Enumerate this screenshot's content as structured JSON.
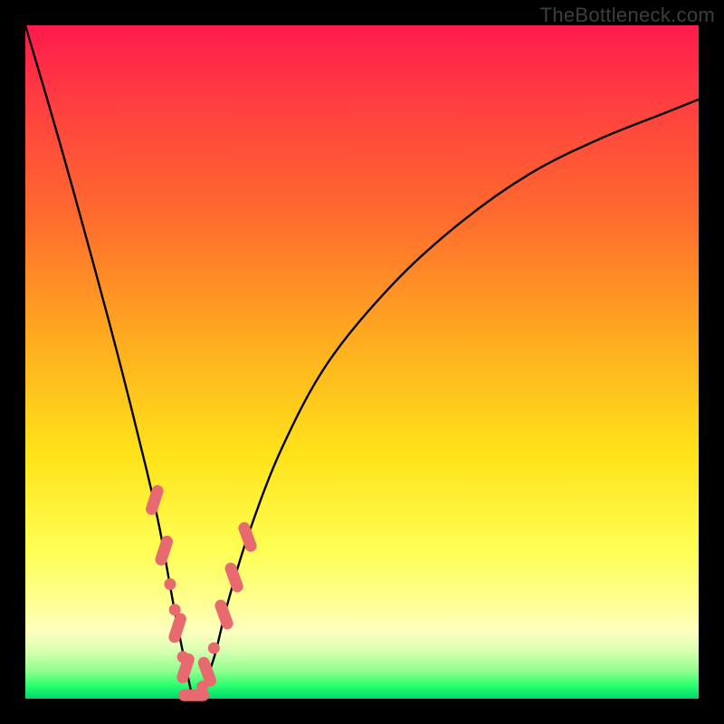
{
  "watermark": "TheBottleneck.com",
  "colors": {
    "curve_stroke": "#000000",
    "marker_fill": "#e86a6f",
    "marker_stroke": "#6b1f22"
  },
  "chart_data": {
    "type": "line",
    "title": "",
    "xlabel": "",
    "ylabel": "",
    "xlim": [
      0,
      100
    ],
    "ylim": [
      0,
      100
    ],
    "grid": false,
    "series": [
      {
        "name": "bottleneck-curve",
        "x": [
          0,
          5,
          10,
          14,
          18,
          20,
          22,
          24,
          25,
          26,
          28,
          30,
          33,
          38,
          45,
          55,
          65,
          75,
          85,
          95,
          100
        ],
        "y": [
          100,
          83,
          65,
          50,
          34,
          25,
          14,
          4,
          0,
          1,
          6,
          14,
          24,
          37,
          50,
          62,
          71,
          78,
          83,
          87,
          89
        ]
      }
    ],
    "markers": [
      {
        "x": 19.2,
        "y": 29.5,
        "shape": "capsule",
        "orient": "left"
      },
      {
        "x": 20.6,
        "y": 22.0,
        "shape": "capsule",
        "orient": "left"
      },
      {
        "x": 21.5,
        "y": 17.0,
        "shape": "dot"
      },
      {
        "x": 22.2,
        "y": 13.2,
        "shape": "dot"
      },
      {
        "x": 22.6,
        "y": 10.5,
        "shape": "capsule",
        "orient": "left"
      },
      {
        "x": 23.4,
        "y": 6.2,
        "shape": "dot"
      },
      {
        "x": 23.8,
        "y": 4.5,
        "shape": "capsule",
        "orient": "left"
      },
      {
        "x": 25.0,
        "y": 0.5,
        "shape": "capsule",
        "orient": "flat"
      },
      {
        "x": 26.3,
        "y": 1.8,
        "shape": "dot"
      },
      {
        "x": 27.0,
        "y": 4.0,
        "shape": "capsule",
        "orient": "right"
      },
      {
        "x": 28.0,
        "y": 7.5,
        "shape": "dot"
      },
      {
        "x": 29.5,
        "y": 12.5,
        "shape": "capsule",
        "orient": "right"
      },
      {
        "x": 31.0,
        "y": 18.0,
        "shape": "capsule",
        "orient": "right"
      },
      {
        "x": 33.0,
        "y": 24.0,
        "shape": "capsule",
        "orient": "right"
      }
    ]
  }
}
